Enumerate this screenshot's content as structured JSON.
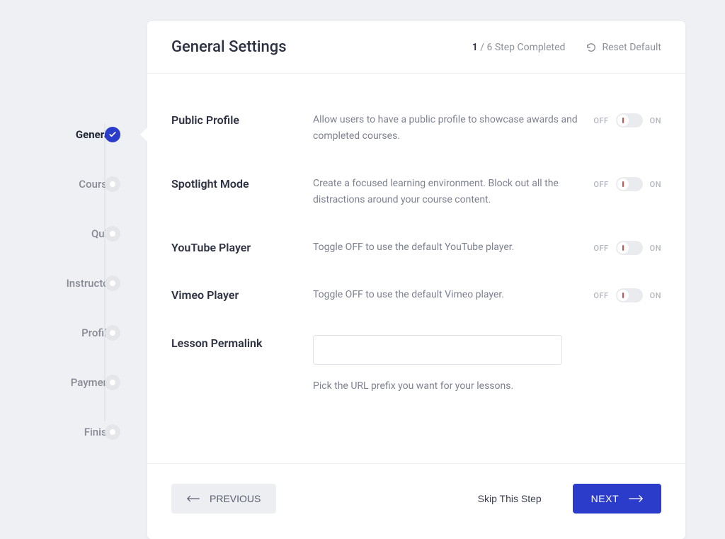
{
  "sidebar": {
    "steps": [
      {
        "label": "General",
        "active": true
      },
      {
        "label": "Course",
        "active": false
      },
      {
        "label": "Quiz",
        "active": false
      },
      {
        "label": "Instructor",
        "active": false
      },
      {
        "label": "Profile",
        "active": false
      },
      {
        "label": "Payment",
        "active": false
      },
      {
        "label": "Finish",
        "active": false
      }
    ]
  },
  "header": {
    "title": "General Settings",
    "progress_current": "1",
    "progress_total": "/ 6 Step Completed",
    "reset_label": "Reset Default"
  },
  "settings": {
    "public_profile": {
      "label": "Public Profile",
      "desc": "Allow users to have a public profile to showcase awards and completed courses.",
      "off": "OFF",
      "on": "ON"
    },
    "spotlight": {
      "label": "Spotlight Mode",
      "desc": "Create a focused learning environment. Block out all the distractions around your course content.",
      "off": "OFF",
      "on": "ON"
    },
    "youtube": {
      "label": "YouTube Player",
      "desc": "Toggle OFF to use the default YouTube player.",
      "off": "OFF",
      "on": "ON"
    },
    "vimeo": {
      "label": "Vimeo Player",
      "desc": "Toggle OFF to use the default Vimeo player.",
      "off": "OFF",
      "on": "ON"
    },
    "permalink": {
      "label": "Lesson Permalink",
      "value": "",
      "help": "Pick the URL prefix you want for your lessons."
    }
  },
  "footer": {
    "previous": "PREVIOUS",
    "skip": "Skip This Step",
    "next": "NEXT"
  }
}
